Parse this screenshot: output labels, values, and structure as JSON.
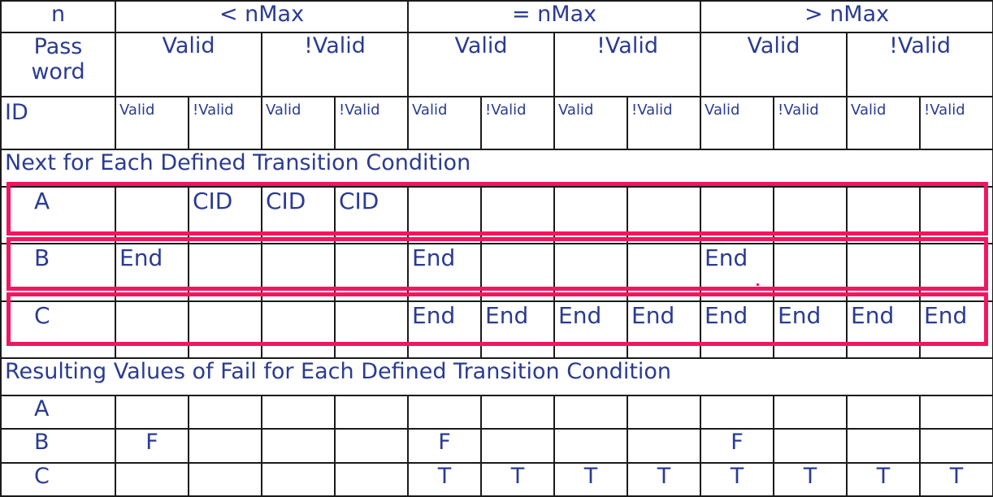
{
  "table": {
    "corner": {
      "n_label": "n",
      "password_label": "Pass word",
      "id_label": "ID"
    },
    "n_groups": [
      {
        "label": "< nMax",
        "span": 4
      },
      {
        "label": "= nMax",
        "span": 4
      },
      {
        "label": "> nMax",
        "span": 4
      }
    ],
    "password_groups": [
      {
        "label": "Valid",
        "span": 2
      },
      {
        "label": "!Valid",
        "span": 2
      },
      {
        "label": "Valid",
        "span": 2
      },
      {
        "label": "!Valid",
        "span": 2
      },
      {
        "label": "Valid",
        "span": 2
      },
      {
        "label": "!Valid",
        "span": 2
      }
    ],
    "id_headers": [
      "Valid",
      "!Valid",
      "Valid",
      "!Valid",
      "Valid",
      "!Valid",
      "Valid",
      "!Valid",
      "Valid",
      "!Valid",
      "Valid",
      "!Valid"
    ],
    "sections": [
      {
        "heading": "Next for Each Defined Transition Condition",
        "rows": [
          {
            "label": "A",
            "values": [
              "",
              "CID",
              "CID",
              "CID",
              "",
              "",
              "",
              "",
              "",
              "",
              "",
              ""
            ],
            "highlighted": true
          },
          {
            "label": "B",
            "values": [
              "End",
              "",
              "",
              "",
              "End",
              "",
              "",
              "",
              "End",
              "",
              "",
              ""
            ],
            "highlighted": true
          },
          {
            "label": "C",
            "values": [
              "",
              "",
              "",
              "",
              "End",
              "End",
              "End",
              "End",
              "End",
              "End",
              "End",
              "End"
            ],
            "highlighted": true
          }
        ]
      },
      {
        "heading": "Resulting Values of Fail for Each Defined Transition Condition",
        "rows": [
          {
            "label": "A",
            "values": [
              "",
              "",
              "",
              "",
              "",
              "",
              "",
              "",
              "",
              "",
              "",
              ""
            ],
            "highlighted": false
          },
          {
            "label": "B",
            "values": [
              "F",
              "",
              "",
              "",
              "F",
              "",
              "",
              "",
              "F",
              "",
              "",
              ""
            ],
            "highlighted": false
          },
          {
            "label": "C",
            "values": [
              "",
              "",
              "",
              "",
              "T",
              "T",
              "T",
              "T",
              "T",
              "T",
              "T",
              "T"
            ],
            "highlighted": false
          }
        ]
      }
    ]
  },
  "colors": {
    "text": "#2a3b92",
    "grid": "#1a1a1a",
    "highlight": "#f4155f",
    "background": "#ffffff"
  }
}
